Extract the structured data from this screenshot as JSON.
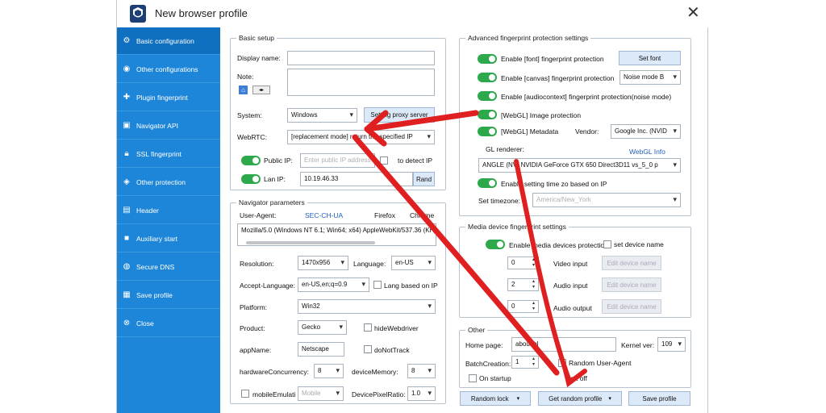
{
  "window": {
    "title": "New browser profile"
  },
  "sidebar": {
    "items": [
      {
        "label": "Basic configuration",
        "icon": "gear-icon"
      },
      {
        "label": "Other configurations",
        "icon": "eye-icon"
      },
      {
        "label": "Plugin fingerprint",
        "icon": "puzzle-icon"
      },
      {
        "label": "Navigator API",
        "icon": "monitor-icon"
      },
      {
        "label": "SSL fingerprint",
        "icon": "lock-icon"
      },
      {
        "label": "Other protection",
        "icon": "shield-icon"
      },
      {
        "label": "Header",
        "icon": "document-icon"
      },
      {
        "label": "Auxiliary start",
        "icon": "on-icon"
      },
      {
        "label": "Secure DNS",
        "icon": "globe-icon"
      },
      {
        "label": "Save profile",
        "icon": "save-icon"
      },
      {
        "label": "Close",
        "icon": "close-circle-icon"
      }
    ]
  },
  "basic_setup": {
    "legend": "Basic setup",
    "display_name_label": "Display name:",
    "note_label": "Note:",
    "system_label": "System:",
    "system_value": "Windows",
    "proxy_button": "Setting proxy server",
    "webrtc_label": "WebRTC:",
    "webrtc_value": "[replacement mode] return the specified IP",
    "public_ip_label": "Public IP:",
    "public_ip_placeholder": "Enter public IP address",
    "auto_detect": "to detect IP",
    "lan_ip_label": "Lan IP:",
    "lan_ip_value": "10.19.46.33",
    "rand_button": "Rand"
  },
  "navigator": {
    "legend": "Navigator parameters",
    "ua_label": "User-Agent:",
    "sec_ch_ua": "SEC-CH-UA",
    "firefox": "Firefox",
    "chrome": "Chrome",
    "ua_value": "Mozilla/5.0 (Windows NT 6.1; Win64; x64) AppleWebKit/537.36 (KH",
    "resolution_label": "Resolution:",
    "resolution_value": "1470x956",
    "language_label": "Language:",
    "language_value": "en-US",
    "accept_language_label": "Accept-Language:",
    "accept_language_value": "en-US,en;q=0.9",
    "lang_based_ip": "Lang based on IP",
    "platform_label": "Platform:",
    "platform_value": "Win32",
    "product_label": "Product:",
    "product_value": "Gecko",
    "hide_webdriver": "hideWebdriver",
    "appname_label": "appName:",
    "appname_value": "Netscape",
    "do_not_track": "doNotTrack",
    "hw_label": "hardwareConcurrency:",
    "hw_value": "8",
    "device_memory_label": "deviceMemory:",
    "device_memory_value": "8",
    "mobile_emul": "mobileEmulati",
    "mobile_value": "Mobile",
    "dpr_label": "DevicePixelRatio:",
    "dpr_value": "1.0"
  },
  "advanced": {
    "legend": "Advanced fingerprint protection settings",
    "font": "Enable [font] fingerprint protection",
    "set_font": "Set font",
    "canvas": "Enable [canvas] fingerprint protection",
    "canvas_mode": "Noise mode B",
    "audio": "Enable [audiocontext] fingerprint  protection(noise mode)",
    "webgl_image": "[WebGL] Image protection",
    "webgl_meta": "[WebGL] Metadata",
    "vendor_label": "Vendor:",
    "vendor_value": "Google Inc. (NVID",
    "renderer_label": "WebGL renderer:",
    "renderer_label_visible": "GL renderer:",
    "webgl_info": "WebGL Info",
    "renderer_value": "ANGLE (NVI        NVIDIA GeForce GTX 650 Direct3D11 vs_5_0 p",
    "time_zone_toggle": "Enable setting time zo        based on IP",
    "timezone_label": "Set timezone:",
    "timezone_value": "America/New_York"
  },
  "media": {
    "legend": "Media device fingerprint settings",
    "enable": "Enable media devices protection",
    "set_device_name": "set device name",
    "video_count": "0",
    "video_label": "Video input",
    "audio_in_count": "2",
    "audio_in_label": "Audio input",
    "audio_out_count": "0",
    "audio_out_label": "Audio output",
    "edit_device_name": "Edit device name"
  },
  "other": {
    "legend": "Other",
    "home_label": "Home page:",
    "home_value": "about:bl",
    "kernel_label": "Kernel ver:",
    "kernel_value": "109",
    "batch_label": "BatchCreation:",
    "batch_value": "1",
    "random_ua": "Random User-Agent",
    "startup": "On startup",
    "left_off": "left off"
  },
  "footer": {
    "random_lock": "Random lock",
    "get_random_profile": "Get random profile",
    "save_profile": "Save profile"
  },
  "annotation": {
    "arrow_color": "#e02020"
  }
}
